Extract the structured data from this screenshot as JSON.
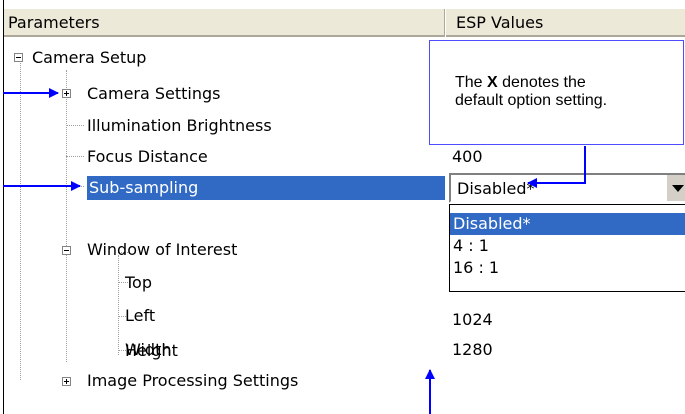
{
  "header": {
    "parameters": "Parameters",
    "esp_values": "ESP Values"
  },
  "tree": {
    "camera_setup": "Camera Setup",
    "camera_settings": "Camera Settings",
    "illumination_brightness": "Illumination Brightness",
    "focus_distance": "Focus Distance",
    "sub_sampling": "Sub-sampling",
    "window_of_interest": "Window of Interest",
    "top": "Top",
    "left": "Left",
    "height": "Height",
    "width": "Width",
    "image_processing_settings": "Image Processing Settings"
  },
  "values": {
    "focus_distance": "400",
    "height": "1024",
    "width": "1280"
  },
  "combo": {
    "selected": "Disabled*",
    "options": [
      "Disabled*",
      "4 : 1",
      "16 : 1"
    ]
  },
  "callout": {
    "pre": "The ",
    "bold": "X",
    "line1_post": " denotes the",
    "line2": "default option setting."
  },
  "colors": {
    "selection": "#316ac5",
    "arrow": "#0000ff",
    "header_bg": "#ece9d8"
  }
}
